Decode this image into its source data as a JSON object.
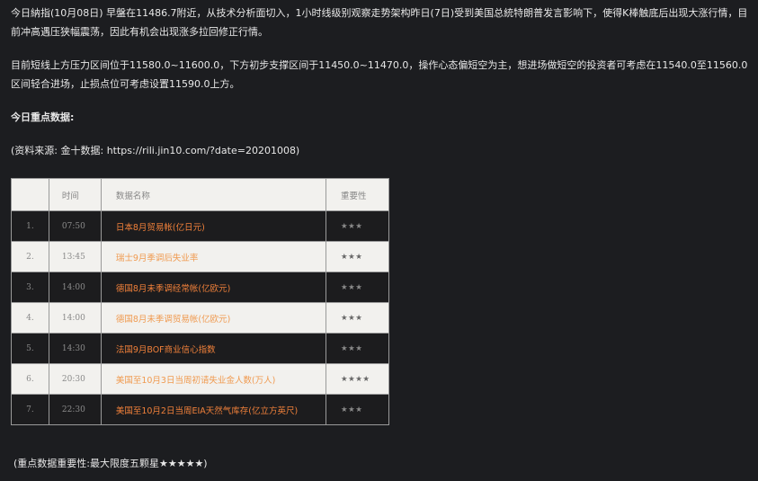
{
  "article": {
    "paragraph1": "今日納指(10月08日) 早盤在11486.7附近，从技术分析面切入，1小时线级别观察走势架构昨日(7日)受到美国总統特朗普发言影响下，使得K棒触底后出现大涨行情，目前冲高遇压狭幅震荡，因此有机会出现涨多拉回修正行情。",
    "paragraph2": "目前短线上方压力区间位于11580.0~11600.0，下方初步支撑区间于11450.0~11470.0，操作心态偏短空为主，想进场做短空的投资者可考虑在11540.0至11560.0区间轻合进场，止损点位可考虑设置11590.0上方。",
    "section_title": "今日重点数据:",
    "source": "(资料来源: 金十数据: https://rili.jin10.com/?date=20201008)",
    "footnote": "(重点数据重要性:最大限度五颗星★★★★★)"
  },
  "table": {
    "headers": {
      "index": "",
      "time": "时间",
      "name": "数据名称",
      "importance": "重要性"
    },
    "rows": [
      {
        "index": "1.",
        "time": "07:50",
        "name": "日本8月贸易帐(亿日元)",
        "stars": "★★★",
        "theme": "dark"
      },
      {
        "index": "2.",
        "time": "13:45",
        "name": "瑞士9月季调后失业率",
        "stars": "★★★",
        "theme": "light"
      },
      {
        "index": "3.",
        "time": "14:00",
        "name": "德国8月未季调经常帐(亿欧元)",
        "stars": "★★★",
        "theme": "dark"
      },
      {
        "index": "4.",
        "time": "14:00",
        "name": "德国8月未季调贸易帐(亿欧元)",
        "stars": "★★★",
        "theme": "light"
      },
      {
        "index": "5.",
        "time": "14:30",
        "name": "法国9月BOF商业信心指数",
        "stars": "★★★",
        "theme": "dark"
      },
      {
        "index": "6.",
        "time": "20:30",
        "name": "美国至10月3日当周初请失业金人数(万人)",
        "stars": "★★★★",
        "theme": "light"
      },
      {
        "index": "7.",
        "time": "22:30",
        "name": "美国至10月2日当周EIA天然气库存(亿立方英尺)",
        "stars": "★★★",
        "theme": "dark"
      }
    ]
  },
  "colors": {
    "background": "#1c1d20",
    "accent_orange": "#f0803a",
    "light_row": "#f2f1ee",
    "dark_row": "#1c1c1e"
  }
}
